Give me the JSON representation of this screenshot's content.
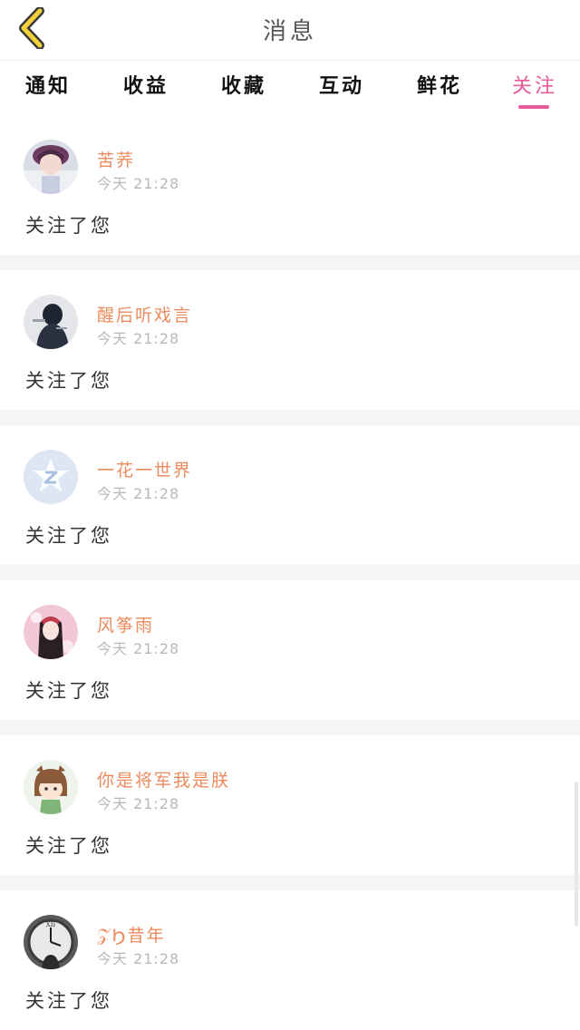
{
  "header": {
    "title": "消息"
  },
  "tabs": [
    "通知",
    "收益",
    "收藏",
    "互动",
    "鲜花",
    "关注"
  ],
  "active_tab": "关注",
  "accent_color": "#e85a9a",
  "name_color": "#ec8b5e",
  "notifications": [
    {
      "username": "苦荞",
      "time": "今天 21:28",
      "message": "关注了您",
      "avatar_icon": "girl-portrait-avatar"
    },
    {
      "username": "醒后听戏言",
      "time": "今天 21:28",
      "message": "关注了您",
      "avatar_icon": "dark-figure-avatar"
    },
    {
      "username": "一花一世界",
      "time": "今天 21:28",
      "message": "关注了您",
      "avatar_icon": "default-qq-avatar"
    },
    {
      "username": "风筝雨",
      "time": "今天 21:28",
      "message": "关注了您",
      "avatar_icon": "doll-avatar"
    },
    {
      "username": "你是将军我是朕",
      "time": "今天 21:28",
      "message": "关注了您",
      "avatar_icon": "cartoon-girl-avatar"
    },
    {
      "username": "𝒵Ϧ昔年",
      "time": "今天 21:28",
      "message": "关注了您",
      "avatar_icon": "clock-avatar"
    }
  ]
}
